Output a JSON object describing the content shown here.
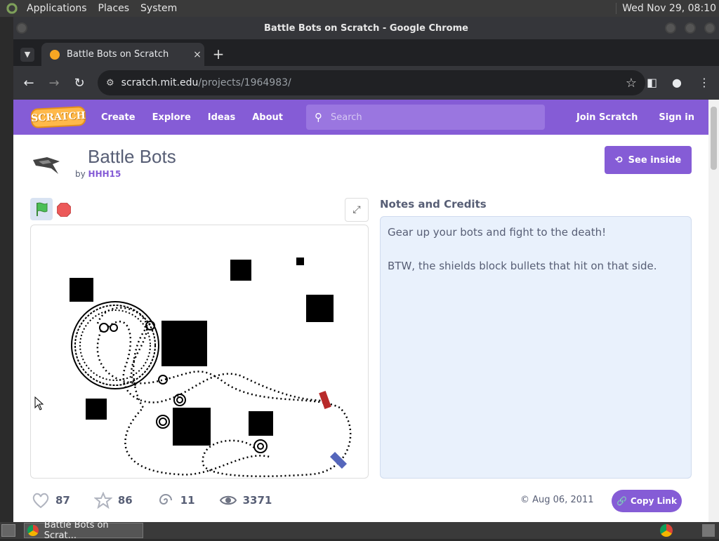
{
  "top_panel": {
    "menus": [
      "Applications",
      "Places",
      "System"
    ],
    "clock": "Wed Nov 29, 08:10"
  },
  "window": {
    "title": "Battle Bots on Scratch - Google Chrome"
  },
  "tab": {
    "title": "Battle Bots on Scratch",
    "close": "×",
    "new": "+"
  },
  "omnibox": {
    "host": "scratch.mit.edu",
    "path": "/projects/1964983/"
  },
  "scratch_nav": {
    "logo": "SCRATCH",
    "links": [
      "Create",
      "Explore",
      "Ideas",
      "About"
    ],
    "search_placeholder": "Search",
    "join": "Join Scratch",
    "signin": "Sign in"
  },
  "project": {
    "title": "Battle Bots",
    "by_prefix": "by",
    "author": "HHH15",
    "see_inside": "See inside"
  },
  "notes": {
    "heading": "Notes and Credits",
    "lines": [
      "Gear up your bots and fight to the death!",
      "BTW, the shields block bullets that hit on that side."
    ]
  },
  "stats": {
    "loves": "87",
    "favorites": "86",
    "remixes": "11",
    "views": "3371"
  },
  "date": "Aug 06, 2011",
  "copy_link": "Copy Link",
  "taskbar": {
    "task": "Battle Bots on Scrat..."
  }
}
